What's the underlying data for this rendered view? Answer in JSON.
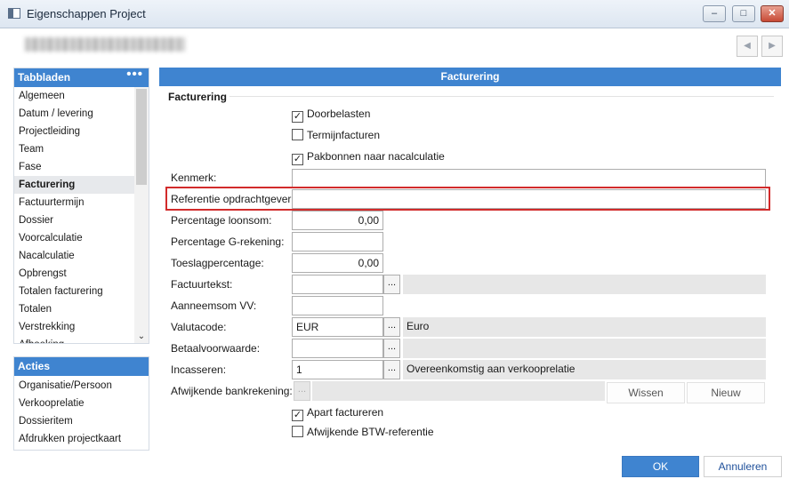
{
  "window": {
    "title": "Eigenschappen Project",
    "min": "‒",
    "max": "□",
    "close": "✕"
  },
  "nav": {
    "prev": "◀",
    "next": "▶"
  },
  "sidebar": {
    "header": "Tabbladen",
    "menu_dots": "•••",
    "items": [
      "Algemeen",
      "Datum / levering",
      "Projectleiding",
      "Team",
      "Fase",
      "Facturering",
      "Factuurtermijn",
      "Dossier",
      "Voorcalculatie",
      "Nacalculatie",
      "Opbrengst",
      "Totalen facturering",
      "Totalen",
      "Verstrekking",
      "Afboeking"
    ],
    "active_index": 5,
    "scroll_down": "⌄"
  },
  "actions": {
    "header": "Acties",
    "items": [
      "Organisatie/Persoon",
      "Verkooprelatie",
      "Dossieritem",
      "Afdrukken projectkaart"
    ]
  },
  "main": {
    "header": "Facturering",
    "section_title": "Facturering",
    "checkboxes": {
      "doorbelasten": {
        "label": "Doorbelasten",
        "checked": true,
        "mark": "✓"
      },
      "termijnfacturen": {
        "label": "Termijnfacturen",
        "checked": false,
        "mark": ""
      },
      "pakbonnen": {
        "label": "Pakbonnen naar nacalculatie",
        "checked": true,
        "mark": "✓"
      },
      "apart": {
        "label": "Apart factureren",
        "checked": true,
        "mark": "✓"
      },
      "btw": {
        "label": "Afwijkende BTW-referentie",
        "checked": false,
        "mark": ""
      }
    },
    "fields": {
      "kenmerk": {
        "label": "Kenmerk:",
        "value": ""
      },
      "referentie": {
        "label": "Referentie opdrachtgever:",
        "value": ""
      },
      "loonsom": {
        "label": "Percentage loonsom:",
        "value": "0,00"
      },
      "grekening": {
        "label": "Percentage G-rekening:",
        "value": ""
      },
      "toeslag": {
        "label": "Toeslagpercentage:",
        "value": "0,00"
      },
      "factuurtekst": {
        "label": "Factuurtekst:",
        "value": "",
        "description": ""
      },
      "aanneemsom": {
        "label": "Aanneemsom VV:",
        "value": ""
      },
      "valutacode": {
        "label": "Valutacode:",
        "value": "EUR",
        "description": "Euro"
      },
      "betaalvoorwaarde": {
        "label": "Betaalvoorwaarde:",
        "value": "",
        "description": ""
      },
      "incasseren": {
        "label": "Incasseren:",
        "value": "1",
        "description": "Overeenkomstig aan verkooprelatie"
      },
      "bankrekening": {
        "label": "Afwijkende bankrekening:",
        "value": ""
      }
    },
    "ellipsis": "...",
    "buttons": {
      "wissen": "Wissen",
      "nieuw": "Nieuw"
    }
  },
  "footer": {
    "ok": "OK",
    "cancel": "Annuleren"
  },
  "colors": {
    "accent": "#3f84d0",
    "highlight": "#d22b2b"
  }
}
